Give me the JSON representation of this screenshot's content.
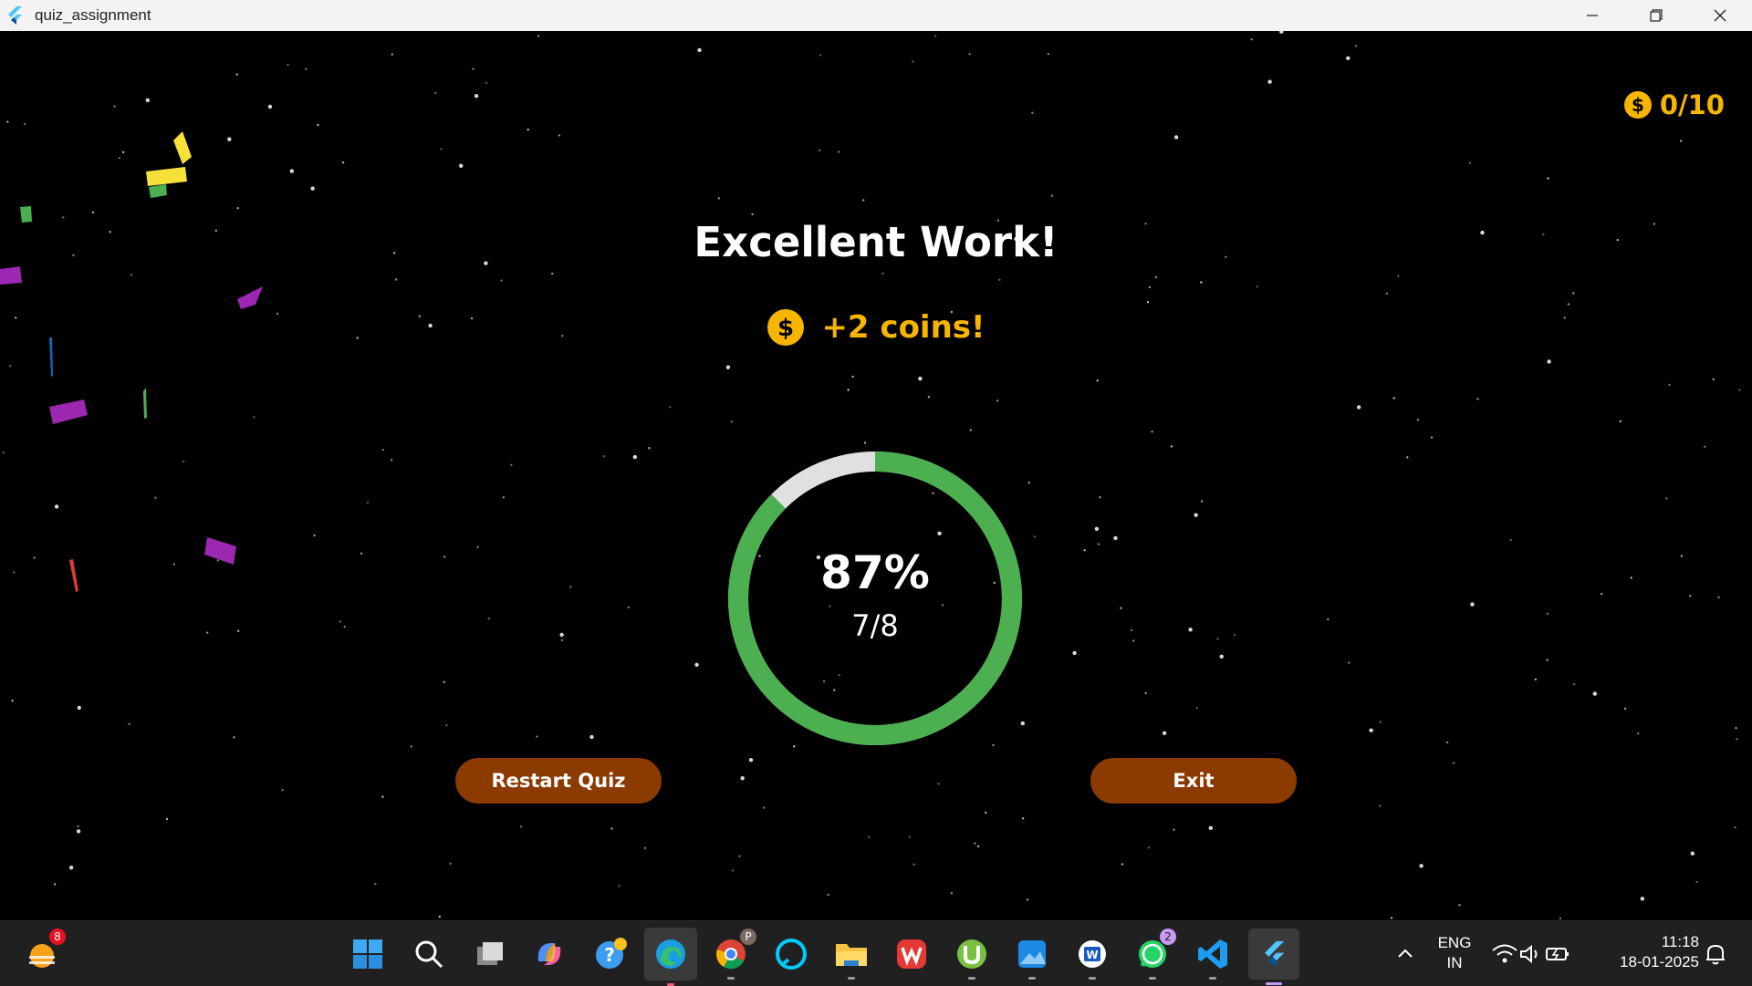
{
  "window": {
    "title": "quiz_assignment"
  },
  "header": {
    "coin_balance": "0/10"
  },
  "result": {
    "title": "Excellent Work!",
    "reward_text": "+2 coins!",
    "percent_label": "87%",
    "score_label": "7/8",
    "progress_fraction": 0.875
  },
  "buttons": {
    "restart_label": "Restart Quiz",
    "exit_label": "Exit"
  },
  "taskbar": {
    "weather_badge": "8",
    "whatsapp_badge": "2",
    "chrome_profile_letter": "P",
    "apps": [
      "weather-icon",
      "windows-start-icon",
      "search-icon",
      "task-view-icon",
      "copilot-icon",
      "help-icon",
      "edge-icon",
      "chrome-icon",
      "alexa-icon",
      "file-explorer-icon",
      "wps-office-icon",
      "utorrent-icon",
      "photos-icon",
      "word-icon",
      "whatsapp-icon",
      "vscode-icon",
      "flutter-icon"
    ]
  },
  "tray": {
    "language": "ENG",
    "region": "IN",
    "time": "11:18",
    "date": "18-01-2025"
  },
  "colors": {
    "coin": "#f7b500",
    "progress": "#4caf50",
    "progress_track": "#e0e0e0",
    "button": "#8b3a00",
    "taskbar": "#202020"
  }
}
